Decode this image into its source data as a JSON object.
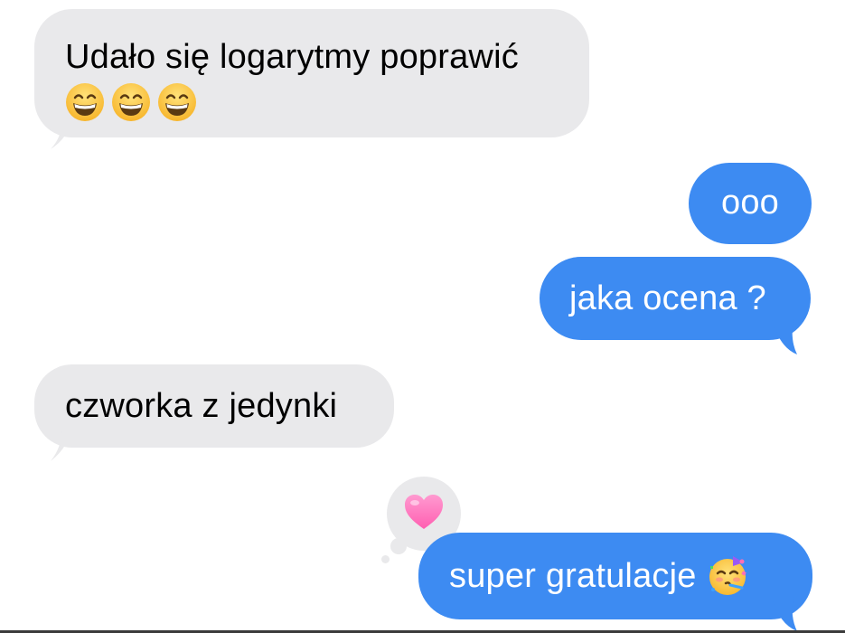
{
  "conversation": {
    "messages": [
      {
        "direction": "incoming",
        "text": "Udało się logarytmy poprawić",
        "emojis": [
          "grinning-face-with-smiling-eyes",
          "grinning-face-with-smiling-eyes",
          "grinning-face-with-smiling-eyes"
        ]
      },
      {
        "direction": "outgoing",
        "text": "ooo"
      },
      {
        "direction": "outgoing",
        "text": "jaka ocena ?"
      },
      {
        "direction": "incoming",
        "text": "czworka z jedynki"
      },
      {
        "direction": "outgoing",
        "text": "super gratulacje",
        "emoji": "partying-face",
        "reaction": "pink-heart"
      }
    ]
  },
  "colors": {
    "incoming_bubble": "#e9e9eb",
    "outgoing_bubble": "#3d8bf2",
    "incoming_text": "#000000",
    "outgoing_text": "#ffffff"
  }
}
